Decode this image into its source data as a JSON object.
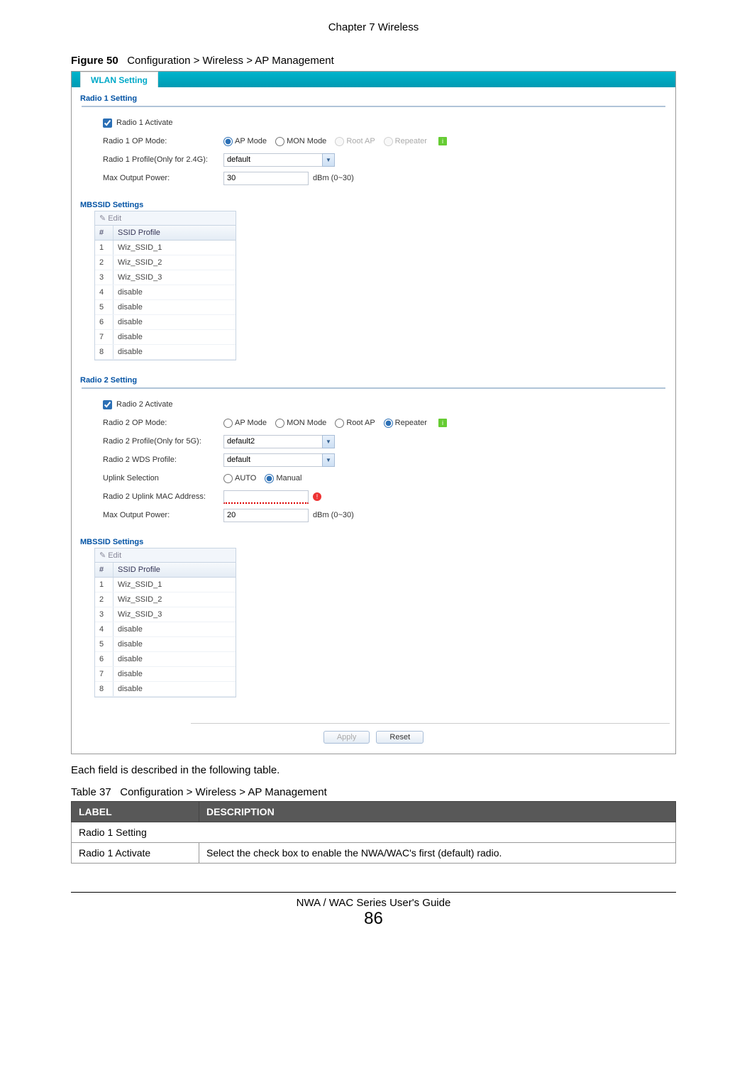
{
  "header": {
    "chapter": "Chapter 7 Wireless"
  },
  "figure": {
    "label": "Figure 50",
    "caption": "Configuration > Wireless > AP Management"
  },
  "screenshot": {
    "tab": "WLAN Setting",
    "radio1": {
      "title": "Radio 1 Setting",
      "activate_label": "Radio 1 Activate",
      "op_mode_label": "Radio 1 OP Mode:",
      "modes": {
        "ap": "AP Mode",
        "mon": "MON Mode",
        "root": "Root AP",
        "rep": "Repeater"
      },
      "profile_label": "Radio 1 Profile(Only for 2.4G):",
      "profile_value": "default",
      "power_label": "Max Output Power:",
      "power_value": "30",
      "power_unit": "dBm (0~30)",
      "mbssid_title": "MBSSID Settings",
      "edit_label": "Edit",
      "table_head_n": "#",
      "table_head_p": "SSID Profile",
      "rows": [
        {
          "n": "1",
          "p": "Wiz_SSID_1"
        },
        {
          "n": "2",
          "p": "Wiz_SSID_2"
        },
        {
          "n": "3",
          "p": "Wiz_SSID_3"
        },
        {
          "n": "4",
          "p": "disable"
        },
        {
          "n": "5",
          "p": "disable"
        },
        {
          "n": "6",
          "p": "disable"
        },
        {
          "n": "7",
          "p": "disable"
        },
        {
          "n": "8",
          "p": "disable"
        }
      ]
    },
    "radio2": {
      "title": "Radio 2 Setting",
      "activate_label": "Radio 2 Activate",
      "op_mode_label": "Radio 2 OP Mode:",
      "modes": {
        "ap": "AP Mode",
        "mon": "MON Mode",
        "root": "Root AP",
        "rep": "Repeater"
      },
      "profile_label": "Radio 2 Profile(Only for 5G):",
      "profile_value": "default2",
      "wds_label": "Radio 2 WDS Profile:",
      "wds_value": "default",
      "uplink_sel_label": "Uplink Selection",
      "uplink_auto": "AUTO",
      "uplink_manual": "Manual",
      "uplink_mac_label": "Radio 2 Uplink MAC Address:",
      "uplink_mac_value": "",
      "power_label": "Max Output Power:",
      "power_value": "20",
      "power_unit": "dBm (0~30)",
      "mbssid_title": "MBSSID Settings",
      "edit_label": "Edit",
      "table_head_n": "#",
      "table_head_p": "SSID Profile",
      "rows": [
        {
          "n": "1",
          "p": "Wiz_SSID_1"
        },
        {
          "n": "2",
          "p": "Wiz_SSID_2"
        },
        {
          "n": "3",
          "p": "Wiz_SSID_3"
        },
        {
          "n": "4",
          "p": "disable"
        },
        {
          "n": "5",
          "p": "disable"
        },
        {
          "n": "6",
          "p": "disable"
        },
        {
          "n": "7",
          "p": "disable"
        },
        {
          "n": "8",
          "p": "disable"
        }
      ]
    },
    "buttons": {
      "apply": "Apply",
      "reset": "Reset"
    }
  },
  "table_intro": "Each field is described in the following table.",
  "doc_table": {
    "caption_label": "Table 37",
    "caption_text": "Configuration > Wireless > AP Management",
    "head_label": "LABEL",
    "head_desc": "DESCRIPTION",
    "rows": [
      {
        "label": "Radio 1 Setting",
        "desc": "",
        "span": true
      },
      {
        "label": "Radio 1 Activate",
        "desc": "Select the check box to enable the NWA/WAC's first (default) radio."
      }
    ]
  },
  "footer": {
    "guide": "NWA / WAC Series User's Guide",
    "page": "86"
  }
}
